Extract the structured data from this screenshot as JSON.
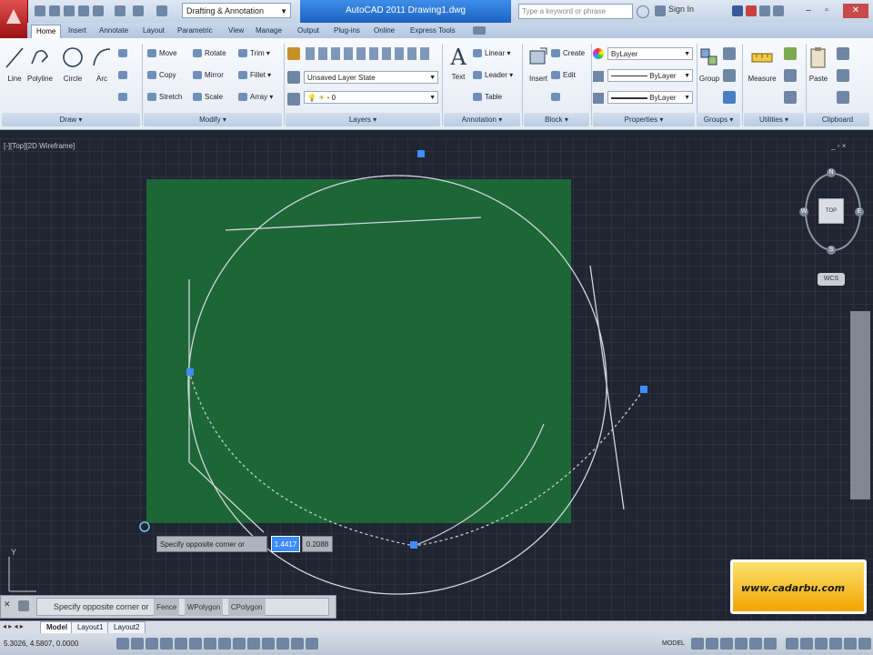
{
  "titlebar": {
    "workspace": "Drafting & Annotation",
    "document_title": "AutoCAD 2011  Drawing1.dwg",
    "search_placeholder": "Type a keyword or phrase",
    "sign_in": "Sign In"
  },
  "tabs": [
    "Home",
    "Insert",
    "Annotate",
    "Layout",
    "Parametric",
    "View",
    "Manage",
    "Output",
    "Plug-ins",
    "Online",
    "Express Tools"
  ],
  "ribbon": {
    "draw": {
      "title": "Draw",
      "tools": [
        "Line",
        "Polyline",
        "Circle",
        "Arc"
      ]
    },
    "modify": {
      "title": "Modify",
      "tools": [
        "Move",
        "Rotate",
        "Trim",
        "Copy",
        "Mirror",
        "Fillet",
        "Stretch",
        "Scale",
        "Array"
      ]
    },
    "layers": {
      "title": "Layers",
      "layer_state": "Unsaved Layer State",
      "current_layer": "0"
    },
    "annotation": {
      "title": "Annotation",
      "text": "Text",
      "linear": "Linear",
      "leader": "Leader",
      "table": "Table"
    },
    "block": {
      "title": "Block",
      "insert": "Insert",
      "create": "Create",
      "edit": "Edit"
    },
    "properties": {
      "title": "Properties",
      "color": "ByLayer",
      "linetype": "ByLayer",
      "lineweight": "ByLayer"
    },
    "groups": {
      "title": "Groups",
      "group": "Group"
    },
    "utilities": {
      "title": "Utilities",
      "measure": "Measure"
    },
    "clipboard": {
      "title": "Clipboard",
      "paste": "Paste"
    }
  },
  "viewport": {
    "label": "[-][Top][2D Wireframe]",
    "controls": "_ ▫ ×",
    "compass": {
      "n": "N",
      "s": "S",
      "e": "E",
      "w": "W"
    },
    "cube_face": "TOP",
    "wcs": "WCS"
  },
  "dynamic_input": {
    "prompt": "Specify opposite corner or",
    "value1": "1.4417",
    "value2": "0.2088"
  },
  "command_line": {
    "close": "✕",
    "text": "Specify opposite corner or",
    "options": [
      "Fence",
      "WPolygon",
      "CPolygon"
    ]
  },
  "layout_tabs": [
    "Model",
    "Layout1",
    "Layout2"
  ],
  "status": {
    "coords": "5.3026, 4.5807, 0.0000",
    "model": "MODEL"
  },
  "logo": {
    "text": "www.cadarbu.com"
  },
  "colors": {
    "canvas": "#1f2531",
    "selection_window": "#1d6b36",
    "grip": "#3f8cff",
    "geometry": "#cfd6de",
    "accent": "#2f7de1"
  }
}
